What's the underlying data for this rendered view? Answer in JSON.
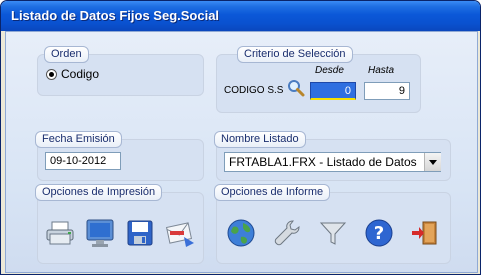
{
  "window": {
    "title": "Listado de Datos Fijos Seg.Social"
  },
  "orden": {
    "title": "Orden",
    "option_label": "Codigo"
  },
  "criterio": {
    "title": "Criterio de Selección",
    "field_label": "CODIGO S.S",
    "desde_header": "Desde",
    "hasta_header": "Hasta",
    "desde_value": "0",
    "hasta_value": "9"
  },
  "fecha": {
    "title": "Fecha Emisión",
    "value": "09-10-2012"
  },
  "listado": {
    "title": "Nombre Listado",
    "selected": "FRTABLA1.FRX - Listado de Datos"
  },
  "impresion": {
    "title": "Opciones de Impresión",
    "icons": [
      "printer-icon",
      "monitor-icon",
      "save-icon",
      "email-icon"
    ]
  },
  "informe": {
    "title": "Opciones de Informe",
    "icons": [
      "globe-icon",
      "wrench-icon",
      "filter-icon",
      "help-icon",
      "exit-door-icon"
    ]
  },
  "colors": {
    "titlebar": "#0a51cf",
    "client": "#d9e5f5",
    "panel": "#d6e1f2",
    "accent": "#1f5fd6"
  }
}
